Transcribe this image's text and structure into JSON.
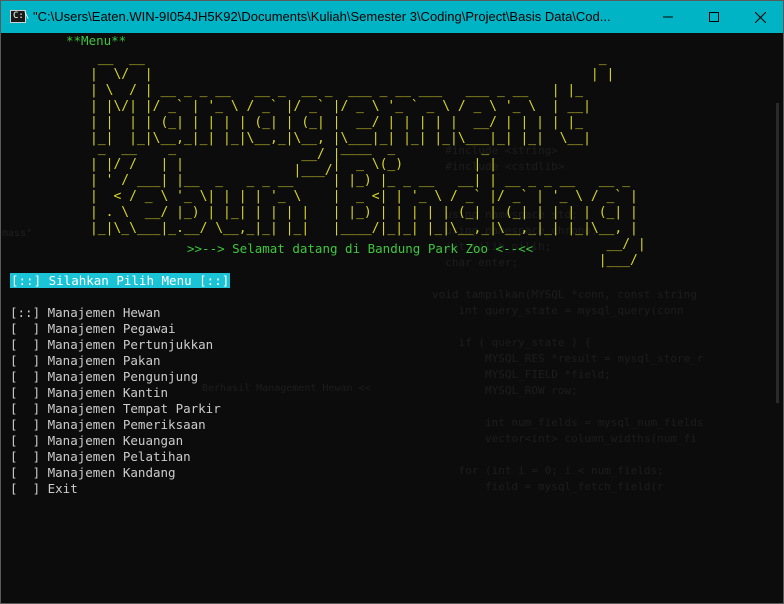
{
  "window": {
    "title": "\"C:\\Users\\Eaten.WIN-9I054JH5K92\\Documents\\Kuliah\\Semester 3\\Coding\\Project\\Basis Data\\Cod..."
  },
  "console": {
    "menu_header": "**Menu**",
    "ascii_line1": [
      " __  __                                                          _   ",
      "|  \\/  |                                                        | |  ",
      "| \\  / | __ _ _ __   __ _  __ _  ___ _ __ ___   ___ _ __   | |_ ",
      "| |\\/| |/ _` | '_ \\ / _` |/ _` |/ _ \\ '_ ` _ \\ / _ \\ '_ \\  | __|",
      "| |  | | (_| | | | | (_| | (_| |  __/ | | | | |  __/ | | | | |_ ",
      "|_|  |_|\\__,_|_| |_|\\__,_|\\__, |\\___|_| |_| |_|\\___|_| |_|  \\__|",
      "                           __/ |                                  ",
      "                          |___/                                   "
    ],
    "ascii_line2": [
      " _  __    _                     ____  _           _                      ",
      "| |/ /   | |                   |  _ \\(_)         | |                     ",
      "| ' / ___| |__  _   _ _ __     | |_) |_ _ __   __| | __ _ _ __   __ _  ",
      "|  < / _ \\ '_ \\| | | | '_ \\    |  _ <| | '_ \\ / _` |/ _` | '_ \\ / _` | ",
      "| . \\  __/ |_) | |_| | | | |   | |_) | | | | | (_| | (_| | | | | (_| | ",
      "|_|\\_\\___|_.__/ \\__,_|_| |_|   |____/|_|_| |_|\\__,_|\\__,_|_| |_|\\__, | ",
      "                                                                  __/ | ",
      "                                                                 |___/  "
    ],
    "welcome": ">>--> Selamat datang di Bandung Park Zoo <--<<",
    "prompt": "[::] Silahkan Pilih Menu [::]",
    "menu_items": [
      "[::] Manajemen Hewan",
      "[  ] Manajemen Pegawai",
      "[  ] Manajemen Pertunjukkan",
      "[  ] Manajemen Pakan",
      "[  ] Manajemen Pengunjung",
      "[  ] Manajemen Kantin",
      "[  ] Manajemen Tempat Parkir",
      "[  ] Manajemen Pemeriksaan",
      "[  ] Manajemen Keuangan",
      "[  ] Manajemen Pelatihan",
      "[  ] Manajemen Kandang",
      "[  ] Exit"
    ]
  },
  "colors": {
    "titlebar": "#00b4c6",
    "console_bg": "#0c0c0c",
    "ascii": "#d6d62a",
    "green_text": "#3ec63e",
    "highlight": "#1ac4d6"
  },
  "icons": {
    "minimize": "minimize-icon",
    "maximize": "maximize-icon",
    "close": "close-icon"
  }
}
